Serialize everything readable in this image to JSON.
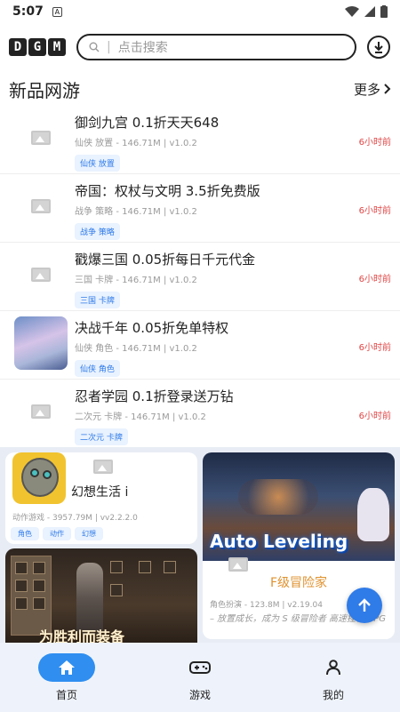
{
  "status_bar": {
    "time": "5:07"
  },
  "header": {
    "logo_letters": [
      "D",
      "G",
      "M"
    ],
    "search_placeholder": "点击搜索",
    "download_icon": "download-circle-icon"
  },
  "section": {
    "title": "新品网游",
    "more_label": "更多"
  },
  "games": [
    {
      "name": "御剑九宫 0.1折天天648",
      "meta": "仙侠 放置 - 146.71M | v1.0.2",
      "tags": [
        "仙侠",
        "放置"
      ],
      "time": "6小时前",
      "thumb": "placeholder"
    },
    {
      "name": "帝国：权杖与文明 3.5折免费版",
      "meta": "战争 策略 - 146.71M | v1.0.2",
      "tags": [
        "战争",
        "策略"
      ],
      "time": "6小时前",
      "thumb": "placeholder"
    },
    {
      "name": "戳爆三国 0.05折每日千元代金",
      "meta": "三国 卡牌 - 146.71M | v1.0.2",
      "tags": [
        "三国",
        "卡牌"
      ],
      "time": "6小时前",
      "thumb": "placeholder"
    },
    {
      "name": "决战千年 0.05折免单特权",
      "meta": "仙侠 角色 - 146.71M | v1.0.2",
      "tags": [
        "仙侠",
        "角色"
      ],
      "time": "6小时前",
      "thumb": "avatar"
    },
    {
      "name": "忍者学园 0.1折登录送万钻",
      "meta": "二次元 卡牌 - 146.71M | v1.0.2",
      "tags": [
        "二次元",
        "卡牌"
      ],
      "time": "6小时前",
      "thumb": "placeholder"
    }
  ],
  "cards": {
    "card1": {
      "name": "幻想生活 i",
      "meta": "动作游戏 - 3957.79M | vv2.2.2.0",
      "tags": [
        "角色",
        "动作",
        "幻想"
      ]
    },
    "card2": {
      "banner_text": "Auto Leveling",
      "name": "F级冒险家",
      "meta": "角色扮演 - 123.8M | v2.19.04",
      "desc": "– 放置成长，成为 S 级冒险者 高速挂机 RPG"
    },
    "card3": {
      "banner_caption": "为胜利而装备"
    }
  },
  "bottom_nav": [
    {
      "label": "首页",
      "icon": "home-icon",
      "active": true
    },
    {
      "label": "游戏",
      "icon": "gamepad-icon",
      "active": false
    },
    {
      "label": "我的",
      "icon": "person-icon",
      "active": false
    }
  ],
  "colors": {
    "accent": "#2f7be8",
    "time_red": "#e04545",
    "tag_bg": "#e9f2ff",
    "card_orange": "#e0922f"
  }
}
